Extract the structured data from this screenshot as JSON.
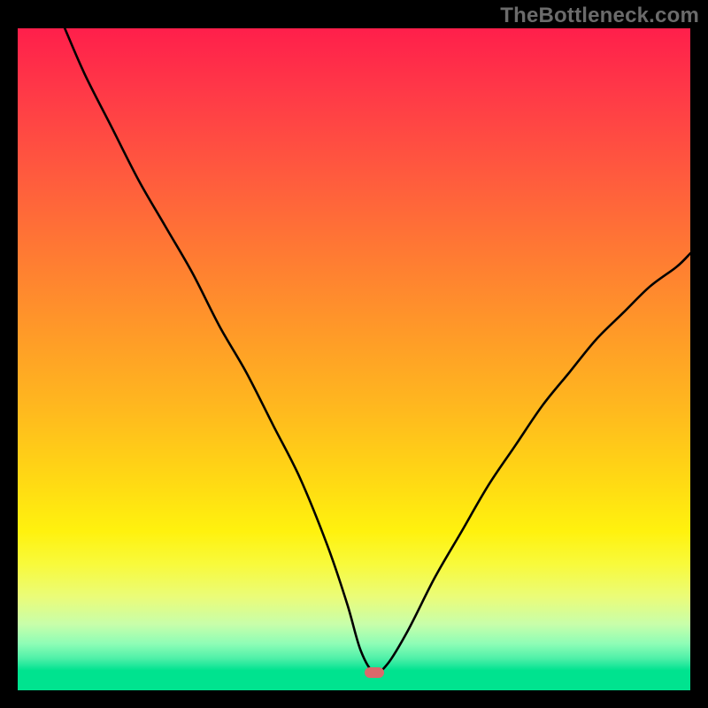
{
  "watermark": "TheBottleneck.com",
  "colors": {
    "background": "#000000",
    "curve": "#000000",
    "marker": "#d9696b",
    "gradient_top": "#ff1f4b",
    "gradient_bottom": "#00e38f"
  },
  "chart_data": {
    "type": "line",
    "title": "",
    "xlabel": "",
    "ylabel": "",
    "xlim": [
      0,
      100
    ],
    "ylim": [
      0,
      100
    ],
    "annotations": [],
    "marker": {
      "x": 53,
      "y": 2.7
    },
    "series": [
      {
        "name": "bottleneck-curve",
        "x": [
          7,
          10,
          14,
          18,
          22,
          26,
          30,
          34,
          38,
          42,
          46,
          49,
          51,
          53,
          55,
          58,
          62,
          66,
          70,
          74,
          78,
          82,
          86,
          90,
          94,
          98,
          100
        ],
        "y": [
          100,
          93,
          85,
          77,
          70,
          63,
          55,
          48,
          40,
          32,
          22,
          13,
          6,
          2.7,
          4,
          9,
          17,
          24,
          31,
          37,
          43,
          48,
          53,
          57,
          61,
          64,
          66
        ]
      }
    ]
  }
}
